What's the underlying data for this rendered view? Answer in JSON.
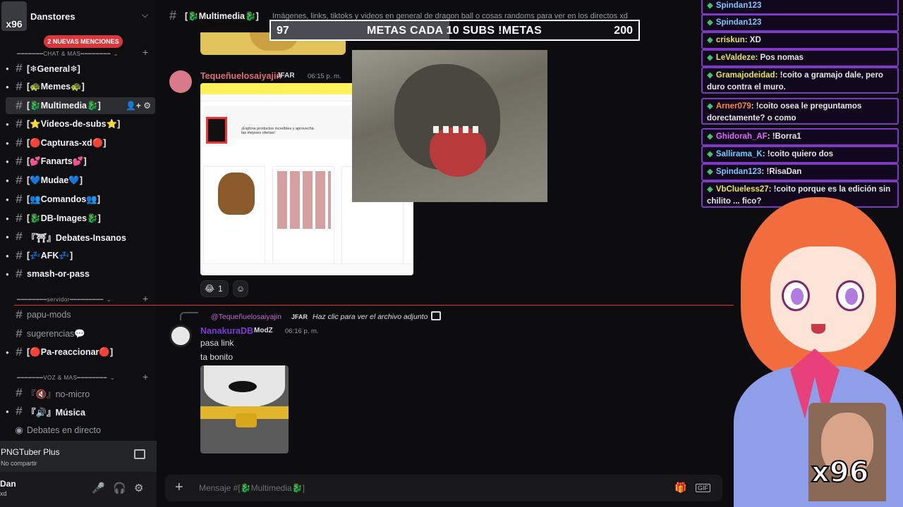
{
  "server": {
    "name": "Danstores",
    "avatar_badge": "x96",
    "mentions": "2 NUEVAS MENCIONES"
  },
  "categories": {
    "chat": "CHAT & MAS",
    "servidor": "servidor",
    "voz": "VOZ & MAS"
  },
  "channels": [
    {
      "label": "[❄General❄]"
    },
    {
      "label": "[🐢Memes🐢]"
    },
    {
      "label": "[🐉Multimedia🐉]"
    },
    {
      "label": "[⭐Videos-de-subs⭐]"
    },
    {
      "label": "[🔴Capturas-xd🔴]"
    },
    {
      "label": "[💕Fanarts💕]"
    },
    {
      "label": "[💙Mudae💙]"
    },
    {
      "label": "[👥Comandos👥]"
    },
    {
      "label": "[🐉DB-Images🐉]"
    },
    {
      "label": "『⛩』Debates-Insanos"
    },
    {
      "label": "[💤AFK💤]"
    },
    {
      "label": "smash-or-pass"
    },
    {
      "label": "papu-mods"
    },
    {
      "label": "sugerencias💬"
    },
    {
      "label": "[🔴Pa-reaccionar🔴]"
    },
    {
      "label": "『🔇』no-micro"
    },
    {
      "label": "『🔊』Música"
    },
    {
      "label": "Debates en directo"
    }
  ],
  "stage": {
    "title": "PNGTuber Plus",
    "subtitle": "No compartir"
  },
  "user": {
    "name": "Dan",
    "status": "xd"
  },
  "channel_header": {
    "title": "[🐉Multimedia🐉]",
    "topic": "Imágenes, links, tiktoks y videos en general de dragon ball o cosas randoms para ver en los directos xd"
  },
  "goal": {
    "current": "97",
    "label": "METAS CADA 10 SUBS !METAS",
    "target": "200",
    "progress": 0.485
  },
  "messages": [
    {
      "author": "Tequeñuelosaiyajin",
      "tag": "JFAR",
      "time": "06:15 p. m.",
      "author_color": "#e06c75"
    },
    {
      "author": "NanakuraDB",
      "tag": "ModZ",
      "time": "06:16 p. m.",
      "author_color": "#7a3bd6",
      "lines": [
        "pasa link",
        "ta bonito"
      ]
    }
  ],
  "reply": {
    "author": "@Tequeñuelosaiyajin",
    "tag": "JFAR",
    "text": "Haz clic para ver el archivo adjunto"
  },
  "reactions": [
    {
      "emoji": "😂",
      "count": "1"
    }
  ],
  "screenshot": {
    "promo": "¡Explora productos increíbles y aprovecha las mejores ofertas!"
  },
  "composer": {
    "placeholder": "Mensaje #[🐉Multimedia🐉]"
  },
  "chat_overlay": [
    {
      "user": "Spindan123",
      "text": ""
    },
    {
      "user": "Spindan123",
      "text": ""
    },
    {
      "user": "criskun",
      "text": ": XD"
    },
    {
      "user": "LeValdeze",
      "text": ": Pos nomas"
    },
    {
      "user": "Gramajodeidad",
      "text": ": !coito a gramajo dale, pero duro contra el muro."
    },
    {
      "user": "Arner079",
      "text": ": !coito osea le preguntamos dorectamente? o como"
    },
    {
      "user": "Ghidorah_AF",
      "text": ": !Borra1"
    },
    {
      "user": "Sallirama_K",
      "text": ": !coito quiero dos"
    },
    {
      "user": "Spindan123",
      "text": ": !RisaDan"
    },
    {
      "user": "VbClueless27",
      "text": ": !coito porque es la edición sin chilito ... fico?"
    }
  ],
  "cam_label": "x96"
}
